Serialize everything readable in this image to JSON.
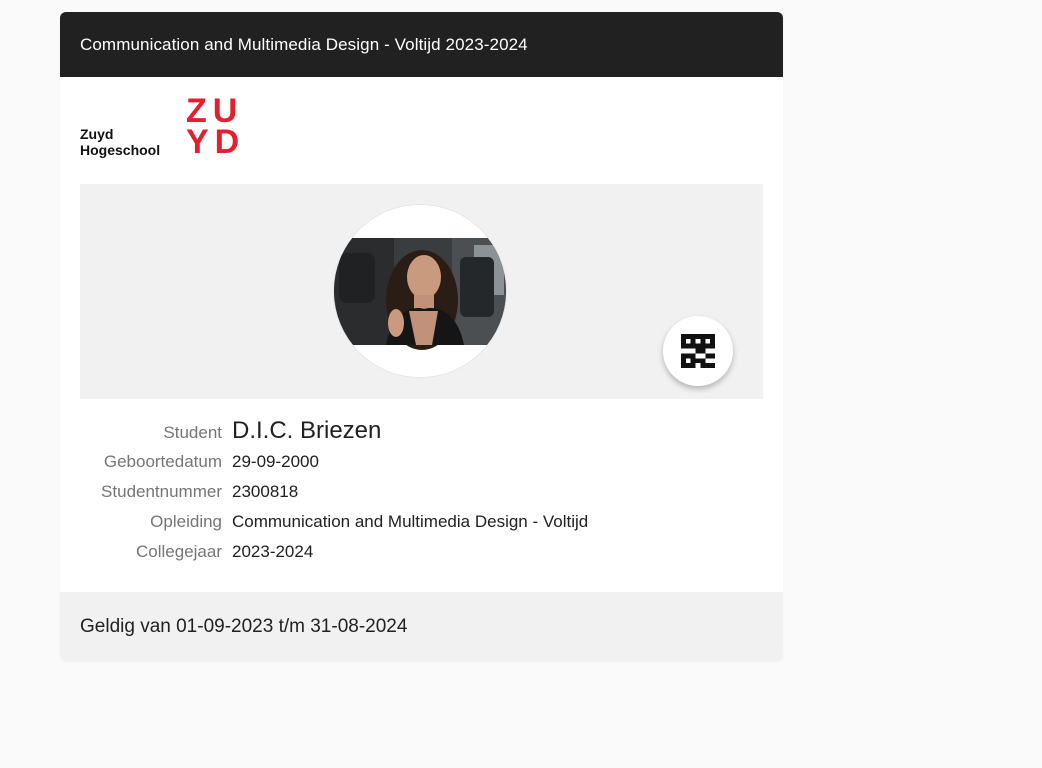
{
  "card": {
    "title": "Communication and Multimedia Design - Voltijd 2023-2024"
  },
  "logo": {
    "line1": "Zuyd",
    "line2": "Hogeschool",
    "mark_line1": "ZU",
    "mark_line2": "YD",
    "brand_color": "#e4202e"
  },
  "photo": {
    "qr_icon": "qr-code-icon"
  },
  "student": {
    "fields": [
      {
        "label": "Student",
        "value": "D.I.C. Briezen"
      },
      {
        "label": "Geboortedatum",
        "value": "29-09-2000"
      },
      {
        "label": "Studentnummer",
        "value": "2300818"
      },
      {
        "label": "Opleiding",
        "value": "Communication and Multimedia Design - Voltijd"
      },
      {
        "label": "Collegejaar",
        "value": "2023-2024"
      }
    ]
  },
  "footer": {
    "validity": "Geldig van 01-09-2023 t/m 31-08-2024"
  },
  "colors": {
    "header_bg": "#212121",
    "panel_bg": "#f1f1f1",
    "label": "#757575",
    "text": "#212121"
  }
}
